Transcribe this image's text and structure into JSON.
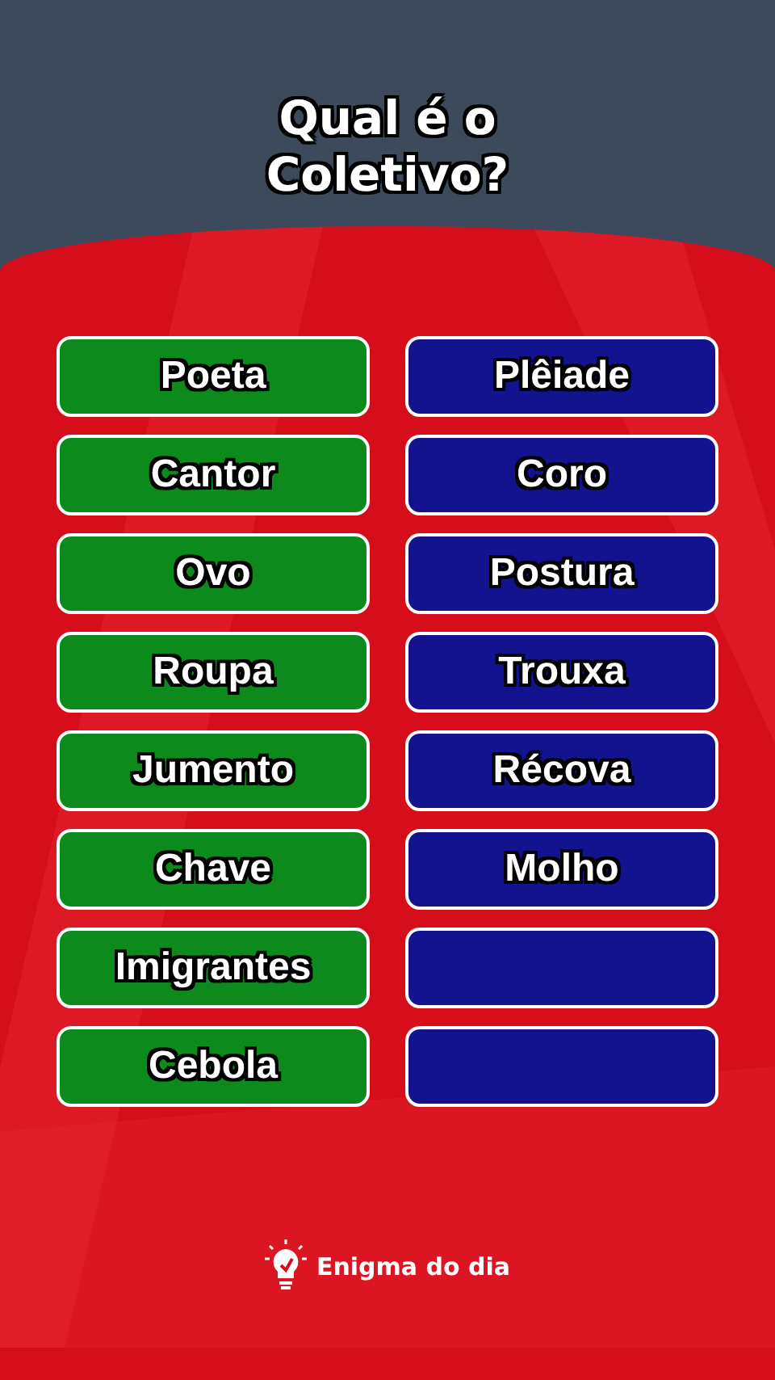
{
  "title": "Qual é o Coletivo?",
  "pairs": [
    {
      "word": "Poeta",
      "answer": "Plêiade"
    },
    {
      "word": "Cantor",
      "answer": "Coro"
    },
    {
      "word": "Ovo",
      "answer": "Postura"
    },
    {
      "word": "Roupa",
      "answer": "Trouxa"
    },
    {
      "word": "Jumento",
      "answer": "Récova"
    },
    {
      "word": "Chave",
      "answer": "Molho"
    },
    {
      "word": "Imigrantes"
    },
    {
      "word": "Cebola"
    }
  ],
  "footer": {
    "brand": "Enigma do dia"
  }
}
